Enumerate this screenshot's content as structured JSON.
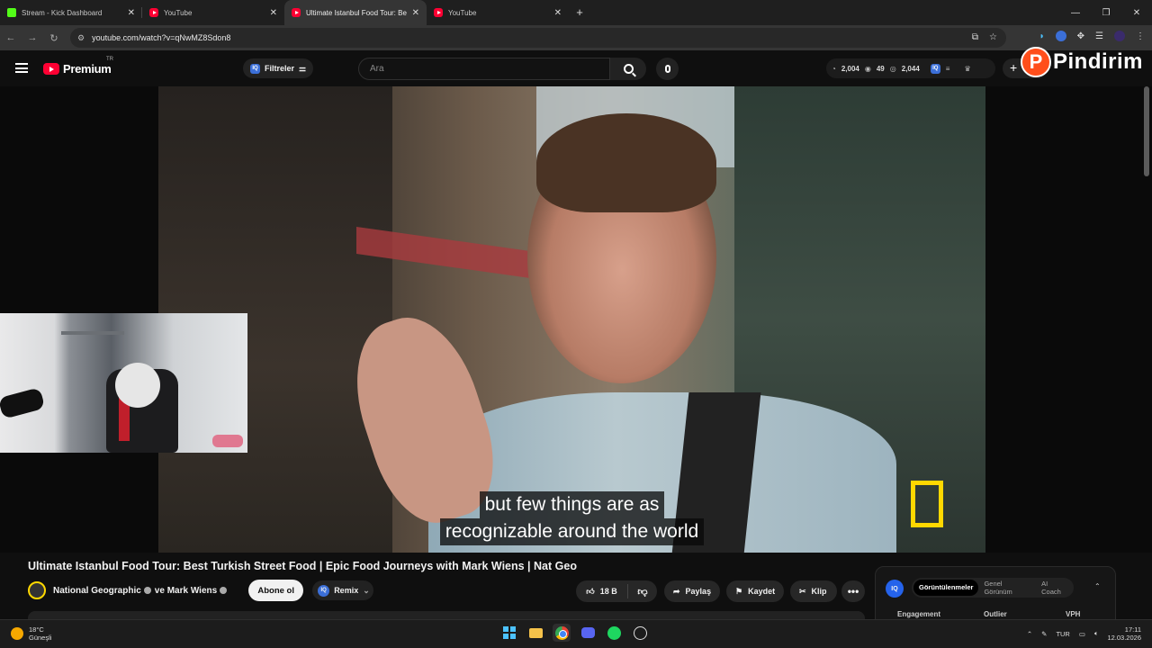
{
  "browser": {
    "tabs": [
      {
        "title": "Stream - Kick Dashboard",
        "favicon": "kick-icon",
        "active": false
      },
      {
        "title": "YouTube",
        "favicon": "youtube-icon",
        "active": false
      },
      {
        "title": "Ultimate Istanbul Food Tour: Be",
        "favicon": "youtube-icon",
        "active": true
      },
      {
        "title": "YouTube",
        "favicon": "youtube-icon",
        "active": false
      }
    ],
    "new_tab": "+",
    "url": "youtube.com/watch?v=qNwMZ8Sdon8"
  },
  "youtube": {
    "logo_text": "Premium",
    "region": "TR",
    "filters_label": "Filtreler",
    "search_placeholder": "Ara",
    "stats": {
      "views": "2,004",
      "likes": "49",
      "watch": "2,044"
    },
    "create_label": "+"
  },
  "overlay": {
    "brand": "Pindirim",
    "brand_letter": "P"
  },
  "video": {
    "subtitle_line1": "but few things are as",
    "subtitle_line2": "recognizable around the world",
    "title": "Ultimate Istanbul Food Tour: Best Turkish Street Food | Epic Food Journeys with Mark Wiens | Nat Geo"
  },
  "channel": {
    "name": "National Geographic",
    "collab": "ve Mark Wiens",
    "subscribe_label": "Abone ol",
    "remix_label": "Remix"
  },
  "actions": {
    "likes": "18 B",
    "share": "Paylaş",
    "save": "Kaydet",
    "clip": "Klip",
    "more": "•••"
  },
  "vidiq": {
    "logo": "IQ",
    "tabs": [
      "Görüntülenmeler",
      "Genel Görünüm",
      "AI Coach"
    ],
    "active_tab": "Görüntülenmeler",
    "columns": [
      "Engagement",
      "Outlier",
      "VPH"
    ]
  },
  "taskbar": {
    "temp": "18°C",
    "weather": "Güneşli",
    "lang": "TUR",
    "time": "17:11",
    "date": "12.03.2026"
  },
  "colors": {
    "accent": "#ff0033",
    "vidiq": "#2563eb",
    "brand": "#ff4e1b"
  }
}
